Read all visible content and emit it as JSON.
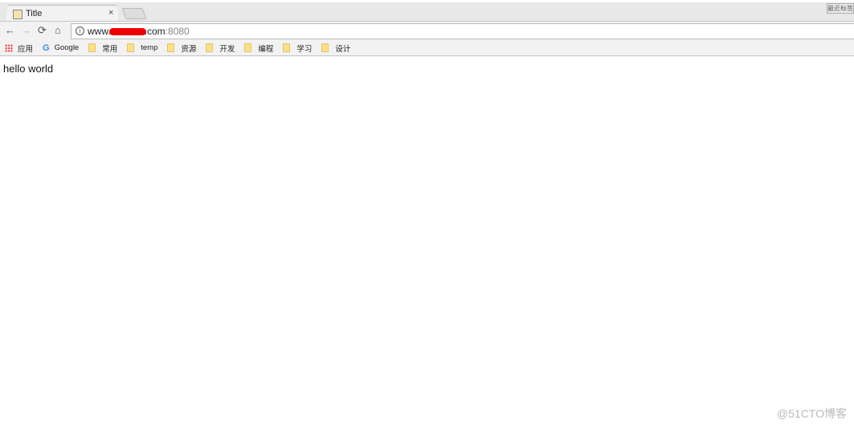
{
  "tab": {
    "title": "Title",
    "close": "×"
  },
  "corner_label": "最近标签",
  "toolbar": {
    "back": "←",
    "forward": "→",
    "reload": "⟳",
    "home": "⌂",
    "url_prefix": "www.",
    "url_suffix": ".com",
    "url_port": ":8080"
  },
  "bookmarks": {
    "apps": "应用",
    "google": "Google",
    "folders": [
      "常用",
      "temp",
      "资源",
      "开发",
      "编程",
      "学习",
      "设计"
    ]
  },
  "page": {
    "text": "hello world"
  },
  "watermark": "@51CTO博客"
}
